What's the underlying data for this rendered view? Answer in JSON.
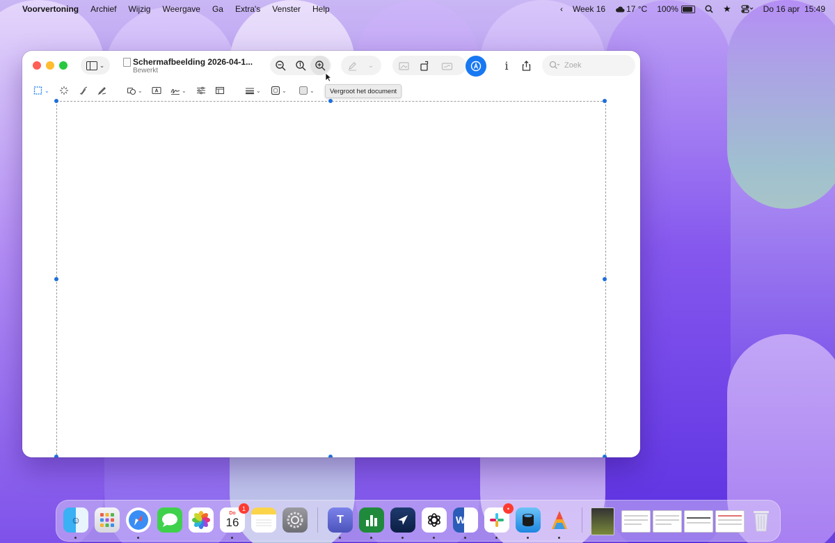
{
  "menubar": {
    "app_name": "Voorvertoning",
    "items": [
      "Archief",
      "Wijzig",
      "Weergave",
      "Ga",
      "Extra's",
      "Venster",
      "Help"
    ],
    "week": "Week 16",
    "weather": "17 °C",
    "battery": "100%",
    "date_time": "Do 16 apr  15:49"
  },
  "window": {
    "title": "Schermafbeelding 2026-04-1...",
    "subtitle": "Bewerkt",
    "search_placeholder": "Zoek",
    "tooltip": "Vergroot het document"
  },
  "dock": {
    "calendar_month": "Do",
    "calendar_day": "16",
    "calendar_badge": "1",
    "slack_badge": "•"
  },
  "colors": {
    "accent": "#1878f2",
    "selection_handle": "#1f6fd8",
    "close": "#ff5f57",
    "minimize": "#febc2e",
    "zoom": "#28c840"
  }
}
